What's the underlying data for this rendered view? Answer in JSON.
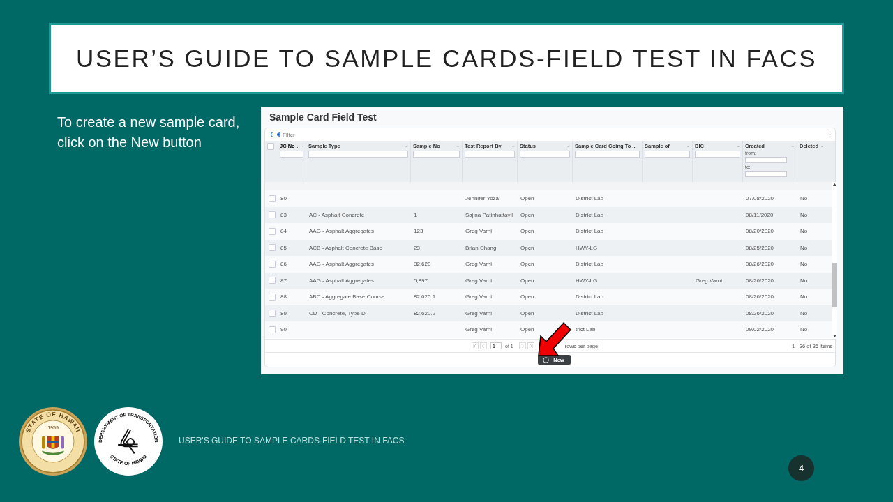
{
  "slide": {
    "title": "USER’S GUIDE TO SAMPLE CARDS-FIELD TEST IN FACS",
    "instruction": "To create a new sample card, click on the New button",
    "footer": "USER'S GUIDE TO SAMPLE CARDS-FIELD TEST IN FACS",
    "page_number": "4"
  },
  "seals": [
    {
      "kind": "state",
      "top": "STATE OF HAWAII",
      "year": "1959"
    },
    {
      "kind": "dot",
      "top": "DEPARTMENT OF TRANSPORTATION",
      "bottom": "STATE OF HAWAII"
    }
  ],
  "app": {
    "title": "Sample Card Field Test",
    "filter_toggle": {
      "label": "Filter",
      "on": true
    },
    "all_checked": false,
    "columns": [
      {
        "label": "JC No",
        "sorted": true,
        "kind": "text"
      },
      {
        "label": "Sample Type",
        "sorted": false,
        "kind": "text"
      },
      {
        "label": "Sample No",
        "sorted": false,
        "kind": "text"
      },
      {
        "label": "Test Report By",
        "sorted": false,
        "kind": "text"
      },
      {
        "label": "Status",
        "sorted": false,
        "kind": "text"
      },
      {
        "label": "Sample Card Going To ...",
        "sorted": false,
        "kind": "text"
      },
      {
        "label": "Sample of",
        "sorted": false,
        "kind": "text"
      },
      {
        "label": "BIC",
        "sorted": false,
        "kind": "text"
      },
      {
        "label": "Created",
        "sorted": false,
        "kind": "date",
        "from_label": "from:",
        "to_label": "to:"
      },
      {
        "label": "Deleted",
        "sorted": false,
        "kind": "none"
      }
    ],
    "rows": [
      {
        "checked": false,
        "cells": [
          "80",
          "",
          "",
          "Jennifer Yoza",
          "Open",
          "District Lab",
          "",
          "",
          "07/08/2020",
          "No"
        ]
      },
      {
        "checked": false,
        "cells": [
          "83",
          "AC - Asphalt Concrete",
          "1",
          "Sajina Patinhattayil",
          "Open",
          "District Lab",
          "",
          "",
          "08/11/2020",
          "No"
        ]
      },
      {
        "checked": false,
        "cells": [
          "84",
          "AAG - Asphalt Aggregates",
          "123",
          "Greg Varni",
          "Open",
          "District Lab",
          "",
          "",
          "08/20/2020",
          "No"
        ]
      },
      {
        "checked": false,
        "cells": [
          "85",
          "ACB - Asphalt Concrete Base",
          "23",
          "Brian Chang",
          "Open",
          "HWY-LG",
          "",
          "",
          "08/25/2020",
          "No"
        ]
      },
      {
        "checked": false,
        "cells": [
          "86",
          "AAG - Asphalt Aggregates",
          "82,620",
          "Greg Varni",
          "Open",
          "District Lab",
          "",
          "",
          "08/26/2020",
          "No"
        ]
      },
      {
        "checked": false,
        "cells": [
          "87",
          "AAG - Asphalt Aggregates",
          "5,897",
          "Greg Varni",
          "Open",
          "HWY-LG",
          "",
          "Greg Varni",
          "08/26/2020",
          "No"
        ]
      },
      {
        "checked": false,
        "cells": [
          "88",
          "ABC - Aggregate Base Course",
          "82,620.1",
          "Greg Varni",
          "Open",
          "District Lab",
          "",
          "",
          "08/26/2020",
          "No"
        ]
      },
      {
        "checked": false,
        "cells": [
          "89",
          "CD - Concrete, Type D",
          "82,620.2",
          "Greg Varni",
          "Open",
          "District Lab",
          "",
          "",
          "08/26/2020",
          "No"
        ]
      },
      {
        "checked": false,
        "cells": [
          "90",
          "",
          "",
          "Greg Varni",
          "Open",
          "trict Lab",
          "",
          "",
          "09/02/2020",
          "No"
        ]
      }
    ],
    "pager": {
      "page": "1",
      "of": "of 1",
      "rows_per_page": "rows per page",
      "summary": "1 - 36 of 36 items"
    },
    "new_button": "New"
  }
}
